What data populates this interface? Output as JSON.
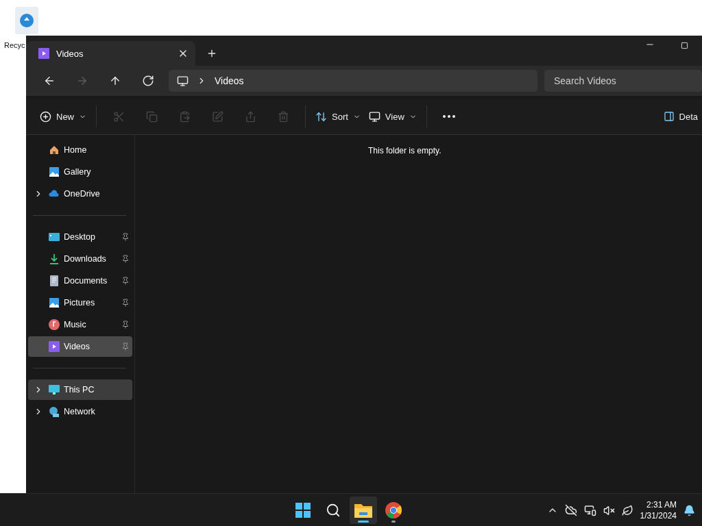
{
  "desktop": {
    "icon_label": "Recyc"
  },
  "window": {
    "tabs": [
      {
        "label": "Videos",
        "selected": true
      }
    ],
    "nav": [
      {
        "kind": "back",
        "disabled": false
      },
      {
        "kind": "forward",
        "disabled": true
      },
      {
        "kind": "up",
        "disabled": false
      },
      {
        "kind": "refresh",
        "disabled": false
      }
    ],
    "breadcrumb": [
      "Videos"
    ],
    "search": {
      "placeholder": "Search Videos"
    },
    "toolbar": [
      {
        "kind": "new",
        "label": "New",
        "disabled": false
      },
      {
        "kind": "sep"
      },
      {
        "kind": "cut",
        "disabled": true
      },
      {
        "kind": "copy",
        "disabled": true
      },
      {
        "kind": "paste",
        "disabled": true
      },
      {
        "kind": "rename",
        "disabled": true
      },
      {
        "kind": "share",
        "disabled": true
      },
      {
        "kind": "delete",
        "disabled": true
      },
      {
        "kind": "sep"
      },
      {
        "kind": "sort",
        "label": "Sort",
        "disabled": false
      },
      {
        "kind": "view",
        "label": "View",
        "disabled": false
      },
      {
        "kind": "sep"
      },
      {
        "kind": "more"
      },
      {
        "kind": "details",
        "label": "Deta",
        "disabled": false
      }
    ],
    "sidebar": [
      [
        {
          "label": "Home",
          "expandable": false,
          "pinned": false,
          "selected": false,
          "hovered": false
        },
        {
          "label": "Gallery",
          "expandable": false,
          "pinned": false,
          "selected": false,
          "hovered": false
        },
        {
          "label": "OneDrive",
          "expandable": true,
          "pinned": false,
          "selected": false,
          "hovered": false
        }
      ],
      [
        {
          "label": "Desktop",
          "expandable": false,
          "pinned": true,
          "selected": false,
          "hovered": false
        },
        {
          "label": "Downloads",
          "expandable": false,
          "pinned": true,
          "selected": false,
          "hovered": false
        },
        {
          "label": "Documents",
          "expandable": false,
          "pinned": true,
          "selected": false,
          "hovered": false
        },
        {
          "label": "Pictures",
          "expandable": false,
          "pinned": true,
          "selected": false,
          "hovered": false
        },
        {
          "label": "Music",
          "expandable": false,
          "pinned": true,
          "selected": false,
          "hovered": false
        },
        {
          "label": "Videos",
          "expandable": false,
          "pinned": true,
          "selected": true,
          "hovered": false
        }
      ],
      [
        {
          "label": "This PC",
          "expandable": true,
          "pinned": false,
          "selected": false,
          "hovered": true
        },
        {
          "label": "Network",
          "expandable": true,
          "pinned": false,
          "selected": false,
          "hovered": false
        }
      ]
    ],
    "empty_message": "This folder is empty."
  },
  "taskbar": {
    "apps": [
      {
        "kind": "start",
        "active": false,
        "running": false
      },
      {
        "kind": "search",
        "active": false,
        "running": false
      },
      {
        "kind": "explorer",
        "active": true,
        "running": true
      },
      {
        "kind": "browser",
        "active": false,
        "running": true
      }
    ],
    "clock": {
      "time": "2:31 AM",
      "date": "1/31/2024"
    }
  }
}
